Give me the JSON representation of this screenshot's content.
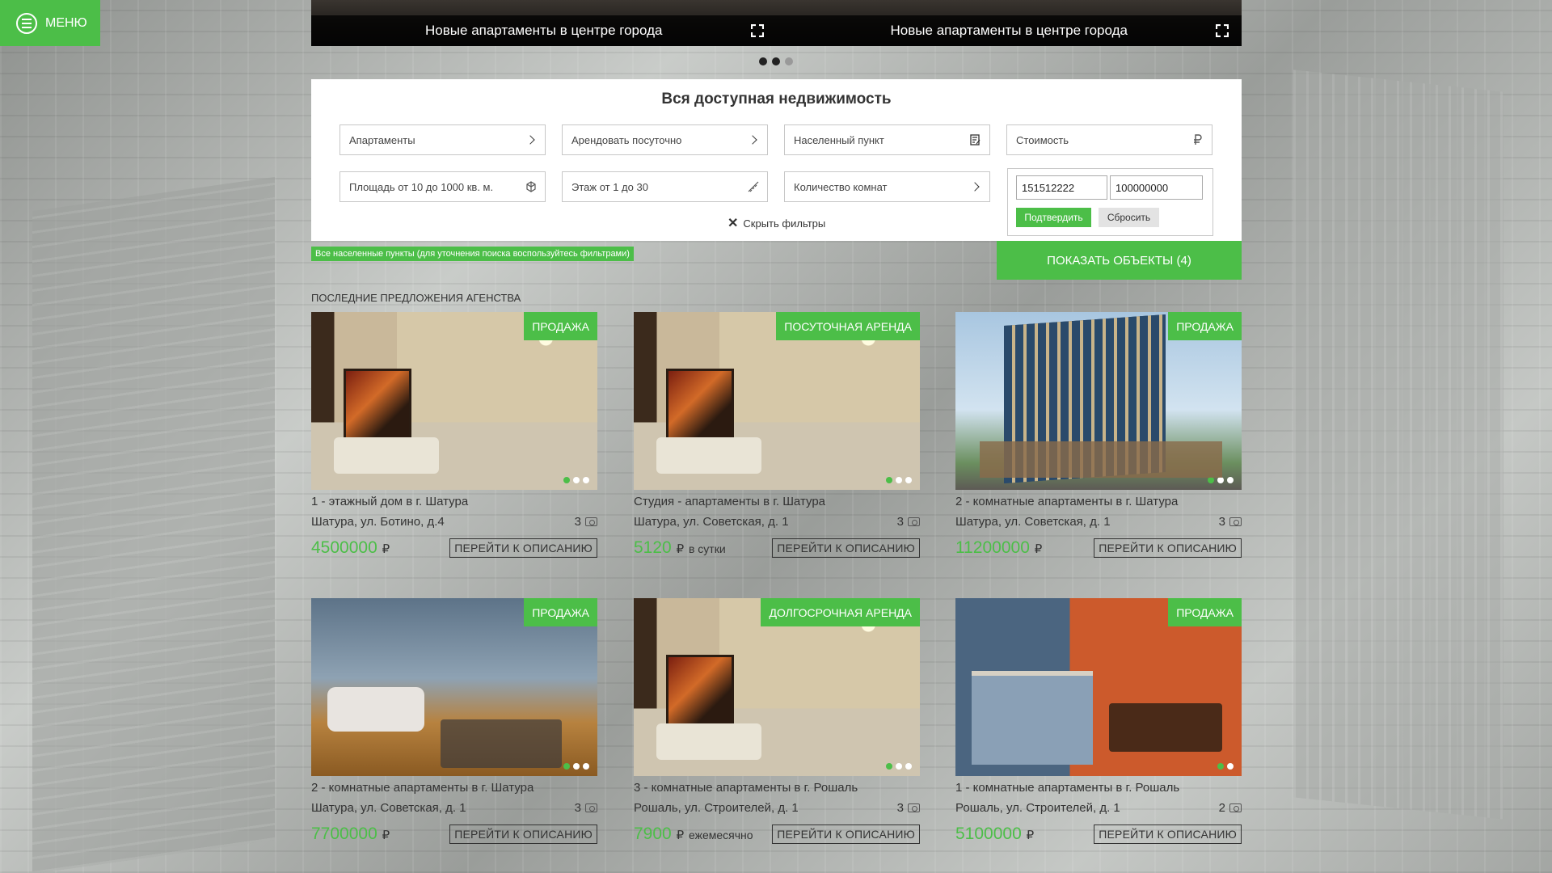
{
  "menu": {
    "label": "МЕНЮ"
  },
  "slider": {
    "slides": [
      {
        "caption": "Новые апартаменты в центре города"
      },
      {
        "caption": "Новые апартаменты в центре города"
      }
    ]
  },
  "filters": {
    "title": "Вся доступная недвижимость",
    "property_type": "Апартаменты",
    "deal_type": "Арендовать посуточно",
    "locality": "Населенный пункт",
    "cost": "Стоимость",
    "area": "Площадь от 10 до 1000 кв. м.",
    "floor": "Этаж от 1 до 30",
    "rooms": "Количество комнат",
    "price_from": "151512222",
    "price_to": "100000000",
    "confirm_label": "Подтвердить",
    "reset_label": "Сбросить",
    "hide_label": "Скрыть фильтры"
  },
  "info_tag": "Все населенные пункты (для уточнения поиска воспользуйтесь фильтрами)",
  "show_button": "ПОКАЗАТЬ ОБЪЕКТЫ (4)",
  "section_title": "ПОСЛЕДНИЕ ПРЕДЛОЖЕНИЯ АГЕНСТВА",
  "desc_button": "ПЕРЕЙТИ К ОПИСАНИЮ",
  "currency": "₽",
  "cards": [
    {
      "badge": "ПРОДАЖА",
      "name": "1 - этажный дом в г. Шатура",
      "address": "Шатура, ул. Ботино, д.4",
      "photos": "3",
      "price": "4500000",
      "per": ""
    },
    {
      "badge": "ПОСУТОЧНАЯ АРЕНДА",
      "name": "Студия - апартаменты в г. Шатура",
      "address": "Шатура, ул. Советская, д. 1",
      "photos": "3",
      "price": "5120",
      "per": "в сутки"
    },
    {
      "badge": "ПРОДАЖА",
      "name": "2 - комнатные апартаменты в г. Шатура",
      "address": "Шатура, ул. Советская, д. 1",
      "photos": "3",
      "price": "11200000",
      "per": ""
    },
    {
      "badge": "ПРОДАЖА",
      "name": "2 - комнатные апартаменты в г. Шатура",
      "address": "Шатура, ул. Советская, д. 1",
      "photos": "3",
      "price": "7700000",
      "per": ""
    },
    {
      "badge": "ДОЛГОСРОЧНАЯ АРЕНДА",
      "name": "3 - комнатные апартаменты в г. Рошаль",
      "address": "Рошаль, ул. Строителей, д. 1",
      "photos": "3",
      "price": "7900",
      "per": "ежемесячно"
    },
    {
      "badge": "ПРОДАЖА",
      "name": "1 - комнатные апартаменты в г. Рошаль",
      "address": "Рошаль, ул. Строителей, д. 1",
      "photos": "2",
      "price": "5100000",
      "per": ""
    }
  ]
}
